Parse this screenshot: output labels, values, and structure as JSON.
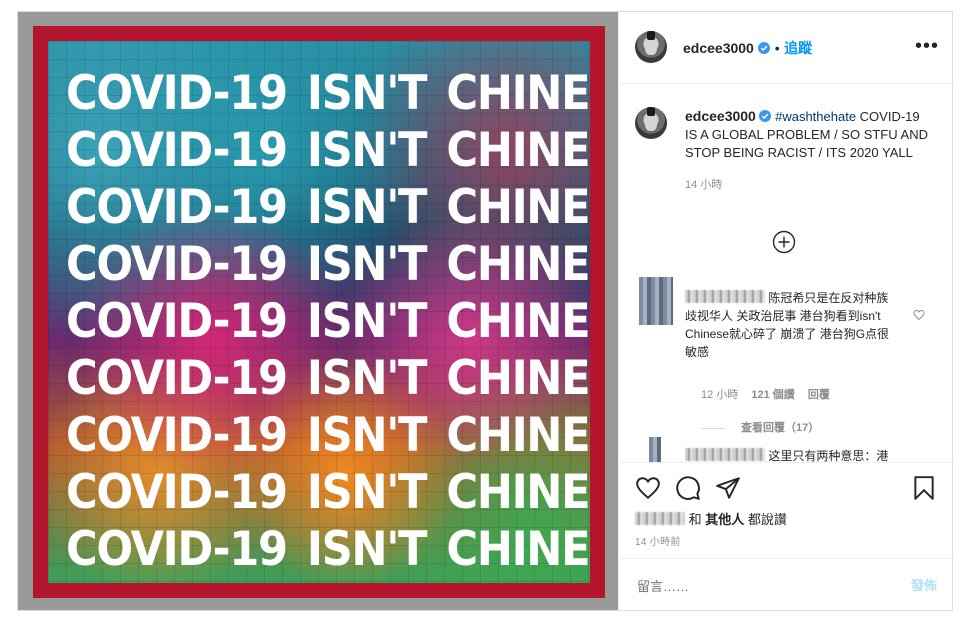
{
  "post": {
    "image": {
      "slogan_word1": "COVID-19",
      "slogan_word2": "ISN'T",
      "slogan_word3": "CHINESE",
      "repeat_count": 9,
      "border_color": "#b4142c"
    },
    "header": {
      "username": "edcee3000",
      "separator": "•",
      "follow_label": "追蹤",
      "more_label": "•••"
    },
    "caption": {
      "username": "edcee3000",
      "hashtag": "#washthehate",
      "text": " COVID-19 IS A GLOBAL PROBLEM / SO STFU AND STOP BEING RACIST / ITS 2020 YALL",
      "time": "14 小時"
    },
    "comments": [
      {
        "text": "陈冠希只是在反对种族歧视华人 关政治屁事 港台狗看到isn't Chinese就心碎了 崩溃了 港台狗G点很敏感",
        "time": "12 小時",
        "likes": "121 個讚",
        "reply_label": "回覆",
        "view_replies": "查看回覆（17）"
      },
      {
        "text": "这里只有两种意思：港"
      }
    ],
    "actions": {
      "liked_by_and": "和",
      "others": "其他人",
      "liked_suffix": "都說讚",
      "posted_ago": "14 小時前"
    },
    "comment_box": {
      "placeholder": "留言……",
      "post_label": "發佈"
    }
  }
}
